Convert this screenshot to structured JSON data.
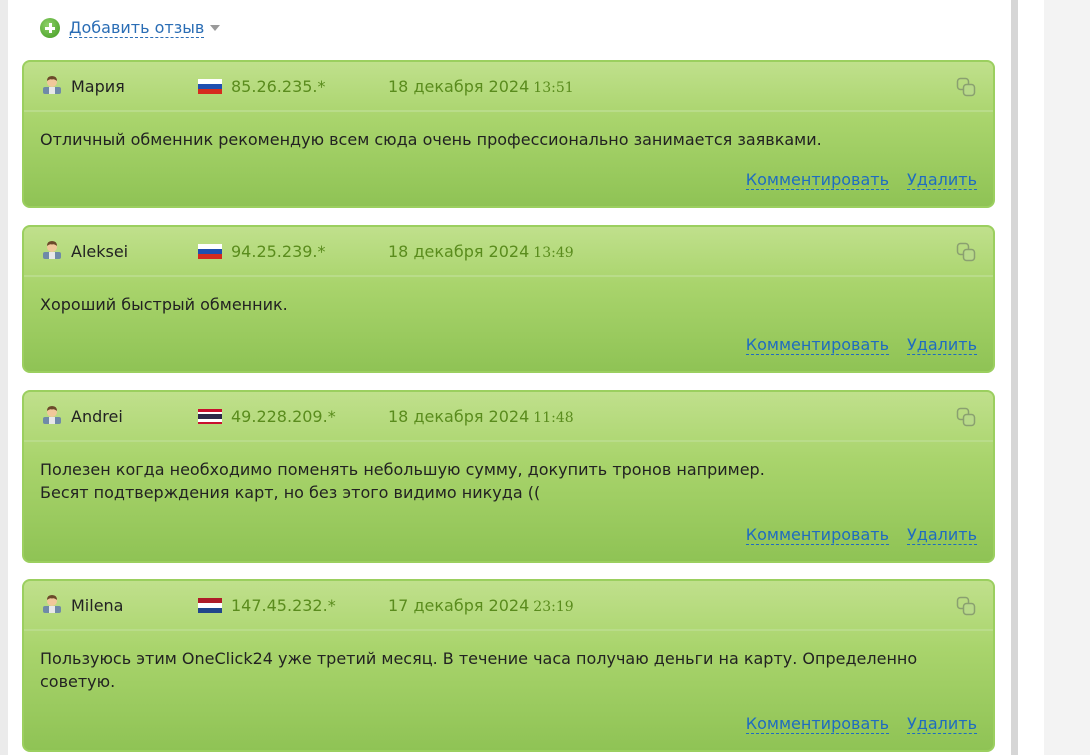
{
  "add_review": {
    "label": "Добавить отзыв"
  },
  "reviews": [
    {
      "name": "Мария",
      "ip": "85.26.235.*",
      "flag": "ru",
      "date": "18 декабря 2024",
      "time": "13:51",
      "text": [
        "Отличный обменник рекомендую всем сюда очень профессионально занимается заявками."
      ],
      "comment_label": "Комментировать",
      "delete_label": "Удалить"
    },
    {
      "name": "Aleksei",
      "ip": "94.25.239.*",
      "flag": "ru",
      "date": "18 декабря 2024",
      "time": "13:49",
      "text": [
        "Хороший быстрый обменник."
      ],
      "comment_label": "Комментировать",
      "delete_label": "Удалить"
    },
    {
      "name": "Andrei",
      "ip": "49.228.209.*",
      "flag": "th",
      "date": "18 декабря 2024",
      "time": "11:48",
      "text": [
        "Полезен когда необходимо поменять небольшую сумму, докупить тронов например.",
        "Бесят подтверждения карт, но без этого видимо никуда (("
      ],
      "comment_label": "Комментировать",
      "delete_label": "Удалить"
    },
    {
      "name": "Milena",
      "ip": "147.45.232.*",
      "flag": "nl",
      "date": "17 декабря 2024",
      "time": "23:19",
      "text": [
        "Пользуюсь этим OneClick24 уже третий месяц. В течение часа получаю деньги на карту. Определенно",
        "советую."
      ],
      "comment_label": "Комментировать",
      "delete_label": "Удалить"
    }
  ],
  "flag_colors": {
    "ru": [
      "#ffffff",
      "#1f4fb0",
      "#d52b1e"
    ],
    "th": [
      "#c8102e",
      "#ffffff",
      "#2d2a4a",
      "#2d2a4a",
      "#ffffff",
      "#c8102e"
    ],
    "nl": [
      "#ae1c28",
      "#ffffff",
      "#21468b"
    ]
  },
  "colors": {
    "link": "#1f6cc0",
    "meta": "#5a8c1d",
    "card_border": "#9bcf5f"
  }
}
